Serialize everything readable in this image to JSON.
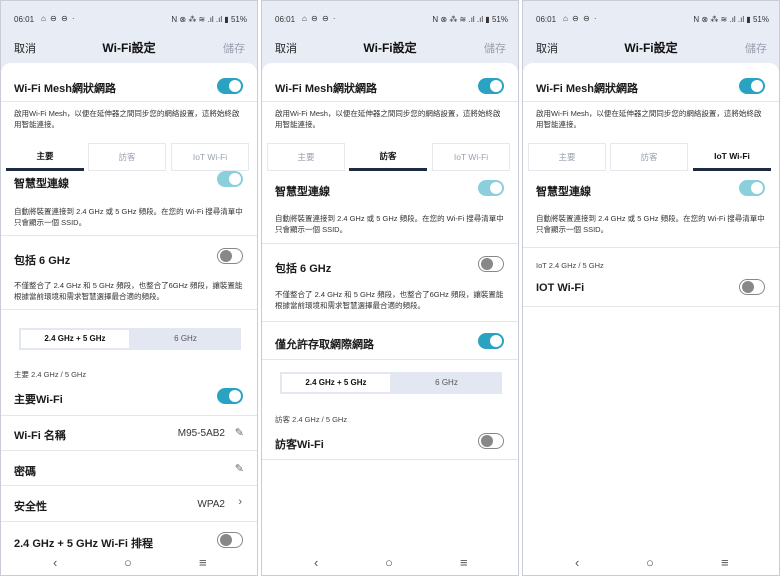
{
  "status": {
    "time": "06:01",
    "icons_left": "⌂ ⊖ ⊖ ·",
    "right": "N ⊗ ⁂ ≋ .ıl .ıl ▮ 51%"
  },
  "nav": {
    "cancel": "取消",
    "title": "Wi-Fi設定",
    "save": "儲存"
  },
  "mesh": {
    "label": "Wi-Fi Mesh網狀網路",
    "desc": "啟用Wi-Fi Mesh，以便在延伸器之間同步您的網絡設置，這將始終啟用智能連接。"
  },
  "tabs": [
    "主要",
    "訪客",
    "IoT Wi-Fi"
  ],
  "smart": {
    "label": "智慧型連線",
    "desc": "自動將裝置連接到 2.4 GHz 或 5 GHz 頻段。在您的 Wi-Fi 搜尋清單中只會顯示一個 SSID。"
  },
  "six": {
    "label": "包括 6 GHz",
    "desc": "不僅整合了 2.4 GHz 和 5 GHz 頻段，也整合了6GHz 頻段，讓裝置能根據當前環境和需求智慧選擇最合適的頻段。"
  },
  "segment": {
    "a": "2.4 GHz + 5 GHz",
    "b": "6 GHz"
  },
  "main": {
    "section": "主要 2.4 GHz / 5 GHz",
    "wifi_label": "主要Wi-Fi",
    "name_label": "Wi-Fi 名稱",
    "name_value": "M95-5AB2",
    "pwd_label": "密碼",
    "sec_label": "安全性",
    "sec_value": "WPA2",
    "sched_label": "2.4 GHz + 5 GHz Wi-Fi 排程"
  },
  "guest": {
    "internet_only": "僅允許存取網際網路",
    "section": "訪客 2.4 GHz / 5 GHz",
    "wifi_label": "訪客Wi-Fi"
  },
  "iot": {
    "section": "IoT 2.4 GHz / 5 GHz",
    "wifi_label": "IOT Wi-Fi"
  },
  "icons": {
    "pencil": "✎",
    "chevron": "›",
    "back": "‹",
    "home": "○",
    "menu": "≡"
  },
  "colors": {
    "accent": "#2aa3c2",
    "header_bg": "#e8ecf5",
    "tab_underline": "#1f2a44"
  }
}
